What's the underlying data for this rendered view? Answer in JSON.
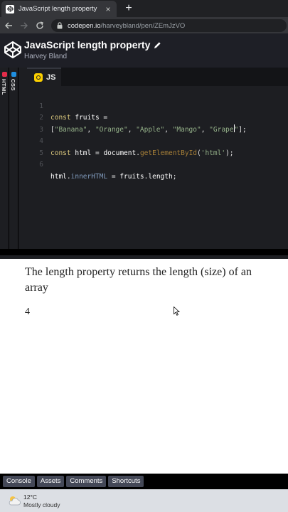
{
  "browser": {
    "tab_title": "JavaScript length property",
    "tab_close": "×",
    "new_tab": "+",
    "url_host": "codepen.io",
    "url_path": "/harveybland/pen/ZEmJzVO"
  },
  "pen": {
    "title": "JavaScript length property",
    "author": "Harvey Bland"
  },
  "editor": {
    "collapsed_panes": [
      "HTML",
      "CSS"
    ],
    "active_tab": "JS",
    "line_numbers": [
      "1",
      "2",
      "3",
      "4",
      "5",
      "6"
    ]
  },
  "preview": {
    "paragraph": "The length property returns the length (size) of an array",
    "result": "4"
  },
  "bottom_bar": {
    "console": "Console",
    "assets": "Assets",
    "comments": "Comments",
    "shortcuts": "Shortcuts"
  },
  "taskbar": {
    "temperature": "12°C",
    "condition": "Mostly cloudy"
  },
  "colors": {
    "html_badge": "#e42c4a",
    "css_badge": "#1f8fe0",
    "js_badge": "#fcd000"
  }
}
